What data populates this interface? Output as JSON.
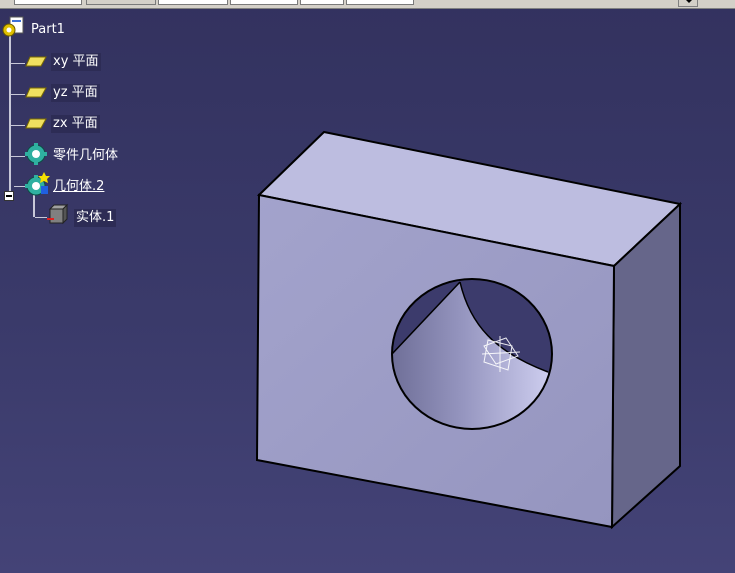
{
  "spec_tree": {
    "root": {
      "label": "Part1",
      "icon": "part-icon"
    },
    "items": [
      {
        "label": "xy 平面",
        "icon": "plane-icon"
      },
      {
        "label": "yz 平面",
        "icon": "plane-icon"
      },
      {
        "label": "zx 平面",
        "icon": "plane-icon"
      },
      {
        "label": "零件几何体",
        "icon": "part-body-icon"
      },
      {
        "label": "几何体.2",
        "icon": "body-icon",
        "expanded": true
      },
      {
        "label": "实体.1",
        "icon": "solid-icon"
      }
    ]
  },
  "viewport": {
    "background_top": "#33325f",
    "background_bottom": "#444377",
    "model": "block with cylindrical through-hole",
    "face_colors": {
      "top": "#bebee0",
      "front": "#9d9dc6",
      "side": "#66668a"
    }
  }
}
